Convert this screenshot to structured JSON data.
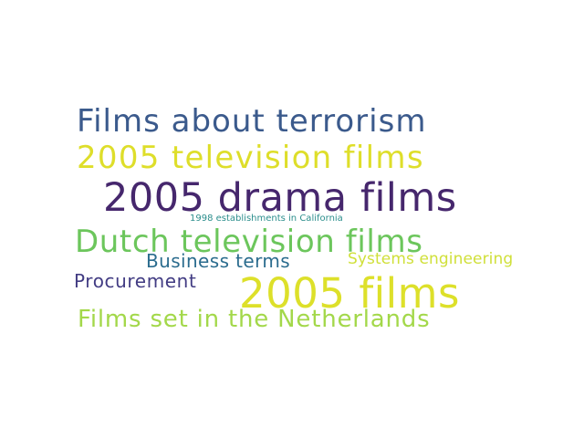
{
  "background": "#ffffff",
  "words": [
    {
      "text": "Films about terrorism",
      "color": "#3b5a8c"
    },
    {
      "text": "2005 television films",
      "color": "#dede2a"
    },
    {
      "text": "2005 drama films",
      "color": "#46276d"
    },
    {
      "text": "1998 establishments in California",
      "color": "#2b8e8c"
    },
    {
      "text": "Dutch television films",
      "color": "#6cc65c"
    },
    {
      "text": "Business terms",
      "color": "#2b6c8e"
    },
    {
      "text": "Systems engineering",
      "color": "#d0e03a"
    },
    {
      "text": "Procurement",
      "color": "#423c83"
    },
    {
      "text": "2005 films",
      "color": "#dde02a"
    },
    {
      "text": "Films set in the Netherlands",
      "color": "#a3d84a"
    }
  ]
}
